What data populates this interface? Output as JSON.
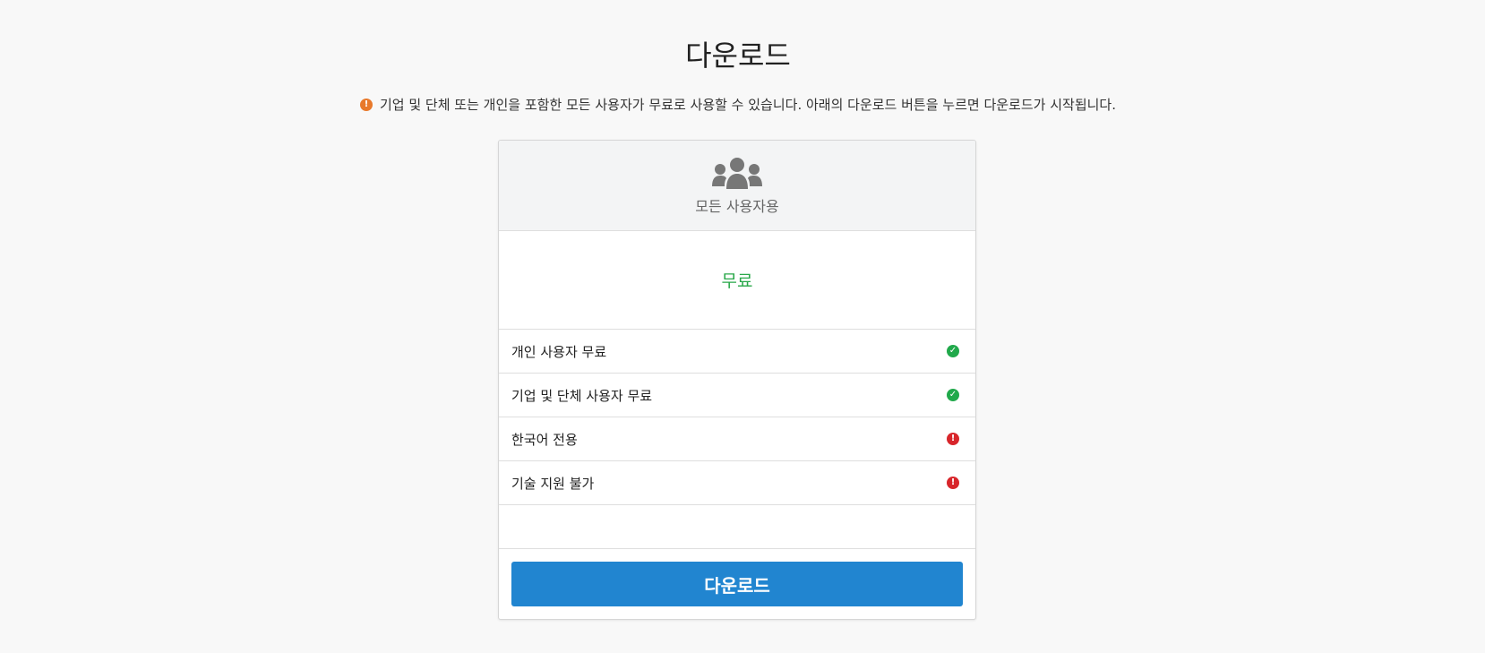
{
  "page": {
    "title": "다운로드",
    "notice": "기업 및 단체 또는 개인을 포함한 모든 사용자가 무료로 사용할 수 있습니다. 아래의 다운로드 버튼을 누르면 다운로드가 시작됩니다.",
    "notice_icon": "exclamation-circle-icon",
    "notice_icon_color": "#e8792b"
  },
  "card": {
    "header_icon": "users-icon",
    "header_label": "모든 사용자용",
    "price": "무료",
    "price_color": "#2aa84a",
    "features": [
      {
        "label": "개인 사용자 무료",
        "status": "included",
        "icon": "check-circle-icon",
        "color": "#21a94b"
      },
      {
        "label": "기업 및 단체 사용자 무료",
        "status": "included",
        "icon": "check-circle-icon",
        "color": "#21a94b"
      },
      {
        "label": "한국어 전용",
        "status": "warning",
        "icon": "exclamation-circle-icon",
        "color": "#d8262b"
      },
      {
        "label": "기술 지원 불가",
        "status": "warning",
        "icon": "exclamation-circle-icon",
        "color": "#d8262b"
      }
    ],
    "button_label": "다운로드",
    "button_color": "#2185d0"
  }
}
